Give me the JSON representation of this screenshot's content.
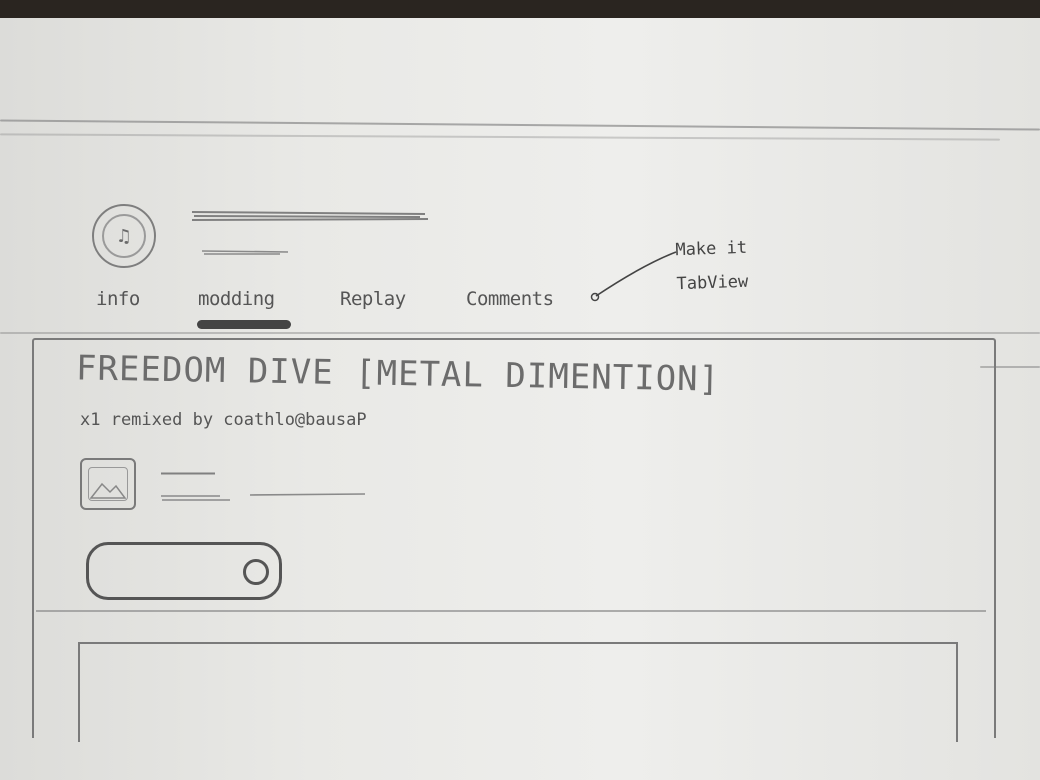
{
  "header": {
    "tabs": [
      {
        "label": "info",
        "active": false
      },
      {
        "label": "modding",
        "active": true
      },
      {
        "label": "Replay",
        "active": false
      },
      {
        "label": "Comments",
        "active": false
      }
    ],
    "annotation": "Make it\nTabView"
  },
  "card": {
    "title": "FREEDOM DIVE [METAL DIMENTION]",
    "subtitle": "x1 remixed by coathlo@bausaP"
  },
  "icons": {
    "avatar": "user-avatar-icon",
    "thumbnail": "image-thumbnail-icon",
    "toggle_knob": "circle-icon"
  }
}
